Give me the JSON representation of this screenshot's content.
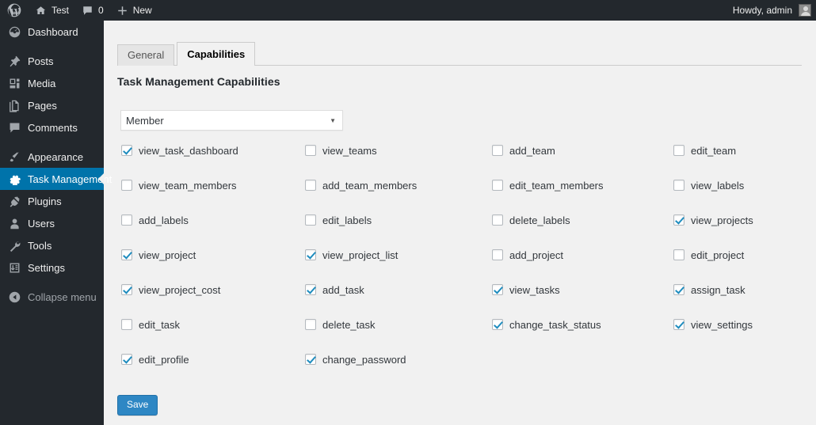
{
  "adminbar": {
    "logo_icon": "wordpress-logo-icon",
    "site_icon": "home-icon",
    "site_name": "Test",
    "comments_icon": "comment-bubble-icon",
    "comments_count": "0",
    "new_icon": "plus-icon",
    "new_label": "New",
    "howdy": "Howdy, admin",
    "avatar_icon": "user-avatar-icon"
  },
  "sidebar": {
    "items": [
      {
        "label": "Dashboard",
        "icon": "dashboard-icon",
        "current": false,
        "gap_after": true
      },
      {
        "label": "Posts",
        "icon": "pin-icon",
        "current": false,
        "gap_after": false
      },
      {
        "label": "Media",
        "icon": "media-icon",
        "current": false,
        "gap_after": false
      },
      {
        "label": "Pages",
        "icon": "pages-icon",
        "current": false,
        "gap_after": false
      },
      {
        "label": "Comments",
        "icon": "comment-bubble-icon",
        "current": false,
        "gap_after": true
      },
      {
        "label": "Appearance",
        "icon": "paintbrush-icon",
        "current": false,
        "gap_after": false
      },
      {
        "label": "Task Management",
        "icon": "gear-icon",
        "current": true,
        "gap_after": false
      },
      {
        "label": "Plugins",
        "icon": "plugin-icon",
        "current": false,
        "gap_after": false
      },
      {
        "label": "Users",
        "icon": "user-icon",
        "current": false,
        "gap_after": false
      },
      {
        "label": "Tools",
        "icon": "wrench-icon",
        "current": false,
        "gap_after": false
      },
      {
        "label": "Settings",
        "icon": "sliders-icon",
        "current": false,
        "gap_after": true
      },
      {
        "label": "Collapse menu",
        "icon": "collapse-arrow-icon",
        "current": false,
        "gap_after": false
      }
    ]
  },
  "tabs": [
    {
      "label": "General",
      "active": false
    },
    {
      "label": "Capabilities",
      "active": true
    }
  ],
  "page_title": "Task Management Capabilities",
  "role_select": {
    "value": "Member",
    "caret_icon": "chevron-down-icon"
  },
  "capabilities": [
    [
      {
        "label": "view_task_dashboard",
        "checked": true
      },
      {
        "label": "view_teams",
        "checked": false
      },
      {
        "label": "add_team",
        "checked": false
      },
      {
        "label": "edit_team",
        "checked": false
      }
    ],
    [
      {
        "label": "view_team_members",
        "checked": false
      },
      {
        "label": "add_team_members",
        "checked": false
      },
      {
        "label": "edit_team_members",
        "checked": false
      },
      {
        "label": "view_labels",
        "checked": false
      }
    ],
    [
      {
        "label": "add_labels",
        "checked": false
      },
      {
        "label": "edit_labels",
        "checked": false
      },
      {
        "label": "delete_labels",
        "checked": false
      },
      {
        "label": "view_projects",
        "checked": true
      }
    ],
    [
      {
        "label": "view_project",
        "checked": true
      },
      {
        "label": "view_project_list",
        "checked": true
      },
      {
        "label": "add_project",
        "checked": false
      },
      {
        "label": "edit_project",
        "checked": false
      }
    ],
    [
      {
        "label": "view_project_cost",
        "checked": true
      },
      {
        "label": "add_task",
        "checked": true
      },
      {
        "label": "view_tasks",
        "checked": true
      },
      {
        "label": "assign_task",
        "checked": true
      }
    ],
    [
      {
        "label": "edit_task",
        "checked": false
      },
      {
        "label": "delete_task",
        "checked": false
      },
      {
        "label": "change_task_status",
        "checked": true
      },
      {
        "label": "view_settings",
        "checked": true
      }
    ],
    [
      {
        "label": "edit_profile",
        "checked": true
      },
      {
        "label": "change_password",
        "checked": true
      }
    ]
  ],
  "save_label": "Save",
  "colors": {
    "adminbar_bg": "#23282d",
    "sidebar_bg": "#23282d",
    "sidebar_current": "#0073aa",
    "content_bg": "#f1f1f1",
    "accent_blue": "#2e87c4",
    "checkbox_check": "#1e8cbe"
  }
}
